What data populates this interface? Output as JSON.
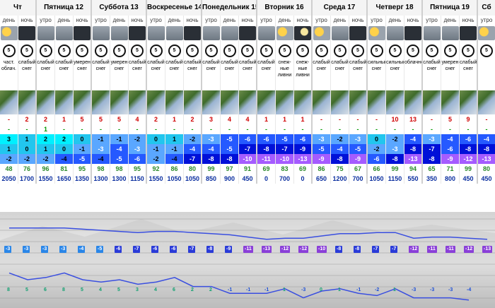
{
  "days": [
    {
      "label": "Чт",
      "cols": 2
    },
    {
      "label": "Пятница 12",
      "cols": 3
    },
    {
      "label": "Суббота 13",
      "cols": 3
    },
    {
      "label": "Воскресенье 14",
      "cols": 3
    },
    {
      "label": "Понедельник 15",
      "cols": 3
    },
    {
      "label": "Вторник 16",
      "cols": 3
    },
    {
      "label": "Среда 17",
      "cols": 3
    },
    {
      "label": "Четверг 18",
      "cols": 3
    },
    {
      "label": "Пятница 19",
      "cols": 3
    },
    {
      "label": "Сб",
      "cols": 1
    }
  ],
  "times": [
    "день",
    "ночь",
    "утро",
    "день",
    "ночь",
    "утро",
    "день",
    "ночь",
    "утро",
    "день",
    "ночь",
    "утро",
    "день",
    "ночь",
    "утро",
    "день",
    "ночь",
    "утро",
    "день",
    "ночь",
    "утро",
    "день",
    "ночь",
    "утро",
    "день",
    "ночь",
    "утро"
  ],
  "icons": [
    "sun",
    "night",
    "cloud",
    "cloud",
    "night",
    "cloud",
    "cloud",
    "night",
    "cloud",
    "cloud",
    "night",
    "cloud",
    "cloud",
    "night",
    "cloud",
    "sun",
    "moon",
    "sun",
    "cloud",
    "night",
    "sun",
    "cloud",
    "night",
    "cloud",
    "cloud",
    "night",
    "sun"
  ],
  "wind": [
    "5",
    "5",
    "5",
    "5",
    "5",
    "5",
    "5",
    "5",
    "5",
    "5",
    "5",
    "5",
    "5",
    "5",
    "5",
    "5",
    "5",
    "5",
    "5",
    "5",
    "5",
    "5",
    "5",
    "5",
    "5",
    "5",
    "5"
  ],
  "descriptions": [
    "част. облач.",
    "слабый снег",
    "слабый снег",
    "слабый снег",
    "умерен снег",
    "слабый снег",
    "умерен снег",
    "слабый снег",
    "слабый снег",
    "слабый снег",
    "слабый снег",
    "слабый снег",
    "слабый снег",
    "слабый снег",
    "слабый снег",
    "снеж-ные ливни",
    "снеж-ные ливни",
    "слабый снег",
    "слабый снег",
    "слабый снег",
    "сильный снег",
    "сильный снег",
    "облачно",
    "слабый снег",
    "умерен снег",
    "слабый снег",
    ""
  ],
  "precip": [
    "-",
    "2",
    "2",
    "1",
    "5",
    "5",
    "5",
    "4",
    "2",
    "1",
    "2",
    "3",
    "4",
    "4",
    "1",
    "1",
    "1",
    "-",
    "-",
    "-",
    "-",
    "10",
    "13",
    "-",
    "5",
    "9",
    "-"
  ],
  "snow": [
    "-",
    "-",
    "1",
    "-",
    "-",
    "-",
    "-",
    "-",
    "-",
    "-",
    "-",
    "-",
    "-",
    "-",
    "-",
    "-",
    "-",
    "-",
    "-",
    "-",
    "-",
    "-",
    "-",
    "-",
    "-",
    "-",
    "-"
  ],
  "temp_max": [
    "3",
    "1",
    "2",
    "2",
    "0",
    "-1",
    "-1",
    "-2",
    "0",
    "1",
    "-2",
    "-3",
    "-5",
    "-6",
    "-6",
    "-5",
    "-6",
    "-3",
    "-2",
    "-3",
    "0",
    "-2",
    "-4",
    "-3",
    "-4",
    "-6",
    "-4"
  ],
  "temp_min": [
    "1",
    "0",
    "1",
    "0",
    "-1",
    "-3",
    "-4",
    "-3",
    "-1",
    "-1",
    "-4",
    "-4",
    "-5",
    "-7",
    "-8",
    "-7",
    "-9",
    "-5",
    "-4",
    "-5",
    "-2",
    "-3",
    "-8",
    "-7",
    "-6",
    "-8",
    "-8"
  ],
  "feels": [
    "-2",
    "-2",
    "-2",
    "-4",
    "-5",
    "-4",
    "-5",
    "-6",
    "-2",
    "-4",
    "-7",
    "-8",
    "-8",
    "-10",
    "-11",
    "-10",
    "-13",
    "-9",
    "-8",
    "-9",
    "-6",
    "-8",
    "-13",
    "-8",
    "-9",
    "-12",
    "-13"
  ],
  "humidity": [
    "48",
    "76",
    "96",
    "81",
    "95",
    "98",
    "98",
    "95",
    "92",
    "86",
    "80",
    "99",
    "97",
    "91",
    "69",
    "83",
    "69",
    "86",
    "75",
    "67",
    "66",
    "99",
    "94",
    "65",
    "71",
    "99",
    "80"
  ],
  "pressure": [
    "2050",
    "1700",
    "1550",
    "1650",
    "1350",
    "1300",
    "1300",
    "1150",
    "1550",
    "1050",
    "1050",
    "850",
    "900",
    "450",
    "0",
    "700",
    "0",
    "650",
    "1200",
    "700",
    "1050",
    "1150",
    "550",
    "350",
    "800",
    "450",
    "450"
  ],
  "graph_top_labels": [
    "-3",
    "-3",
    "-3",
    "-3",
    "-4",
    "-5",
    "-6",
    "-7",
    "-6",
    "-6",
    "-7",
    "-8",
    "-9",
    "-11",
    "-13",
    "-12",
    "-12",
    "-10",
    "-8",
    "-8",
    "-7",
    "-7",
    "-12",
    "-11",
    "-11",
    "-12",
    "-13"
  ],
  "graph_bottom_labels": [
    "8",
    "5",
    "6",
    "8",
    "5",
    "4",
    "5",
    "3",
    "4",
    "6",
    "2",
    "2",
    "-1",
    "-1",
    "-1",
    "1",
    "-3",
    "0",
    "1",
    "-1",
    "-2",
    "1",
    "-3",
    "-3",
    "-3",
    "-4",
    ""
  ],
  "colors": {
    "warm_cell": "#00f0ff",
    "mild_cell": "#22c6ee",
    "cool_cell": "#5aa7ff",
    "cold_cell": "#2559ff",
    "very_cold_cell": "#0010d8",
    "feels_cold": "#a55cff",
    "humidity_text": "#2a8a2a",
    "pressure_text": "#0a2e9f"
  }
}
